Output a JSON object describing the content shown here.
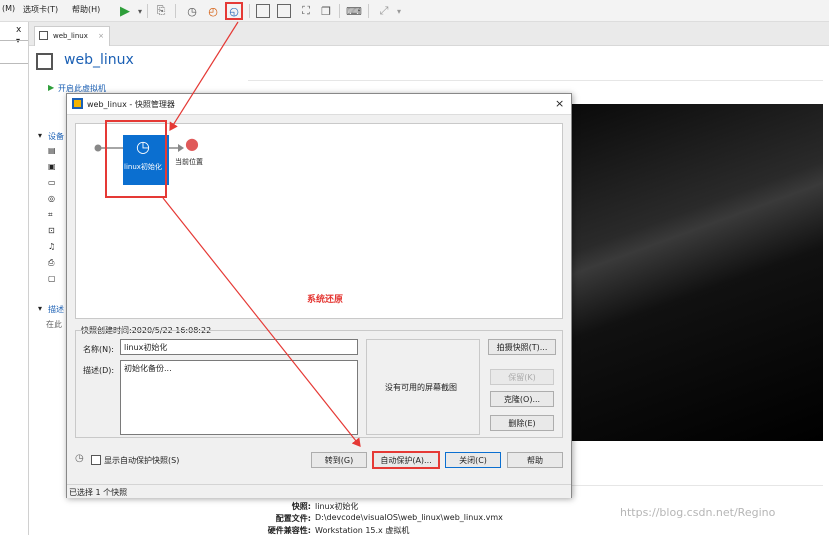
{
  "menubar": {
    "items": [
      "(M)",
      "选项卡(T)",
      "帮助(H)"
    ]
  },
  "vm_tab": {
    "label": "web_linux"
  },
  "vm_title": "web_linux",
  "sidebar": {
    "start_vm": "开启此虚拟机",
    "devices_prefix": "设备",
    "desc_prefix": "描述",
    "desc_text": "在此"
  },
  "dialog": {
    "title": "web_linux - 快照管理器",
    "snapshot_node_label": "linux初始化",
    "current_position_label": "当前位置",
    "restore_note": "系统还原",
    "created_time": "快照创建时间:2020/5/22 16:08:22",
    "name_label": "名称(N):",
    "name_value": "linux初始化",
    "desc_label": "描述(D):",
    "desc_value": "初始化备份...",
    "no_screenshot": "没有可用的屏幕截图",
    "buttons": {
      "take": "拍摄快照(T)...",
      "keep": "保留(K)",
      "clone": "克隆(O)...",
      "delete": "删除(E)",
      "goto": "转到(G)",
      "autoprotect": "自动保护(A)...",
      "close": "关闭(C)",
      "help": "帮助"
    },
    "show_autoprotect": "显示自动保护快照(S)",
    "status": "已选择 1 个快照"
  },
  "summary": {
    "rows": [
      {
        "label": "快照:",
        "value": "linux初始化"
      },
      {
        "label": "配置文件:",
        "value": "D:\\devcode\\visualOS\\web_linux\\web_linux.vmx"
      },
      {
        "label": "硬件兼容性:",
        "value": "Workstation 15.x 虚拟机"
      }
    ]
  },
  "watermark": "https://blog.csdn.net/Regino",
  "colors": {
    "accent": "#1a5fb4",
    "annotation": "#e53935",
    "selected_node": "#0b6fd0"
  }
}
